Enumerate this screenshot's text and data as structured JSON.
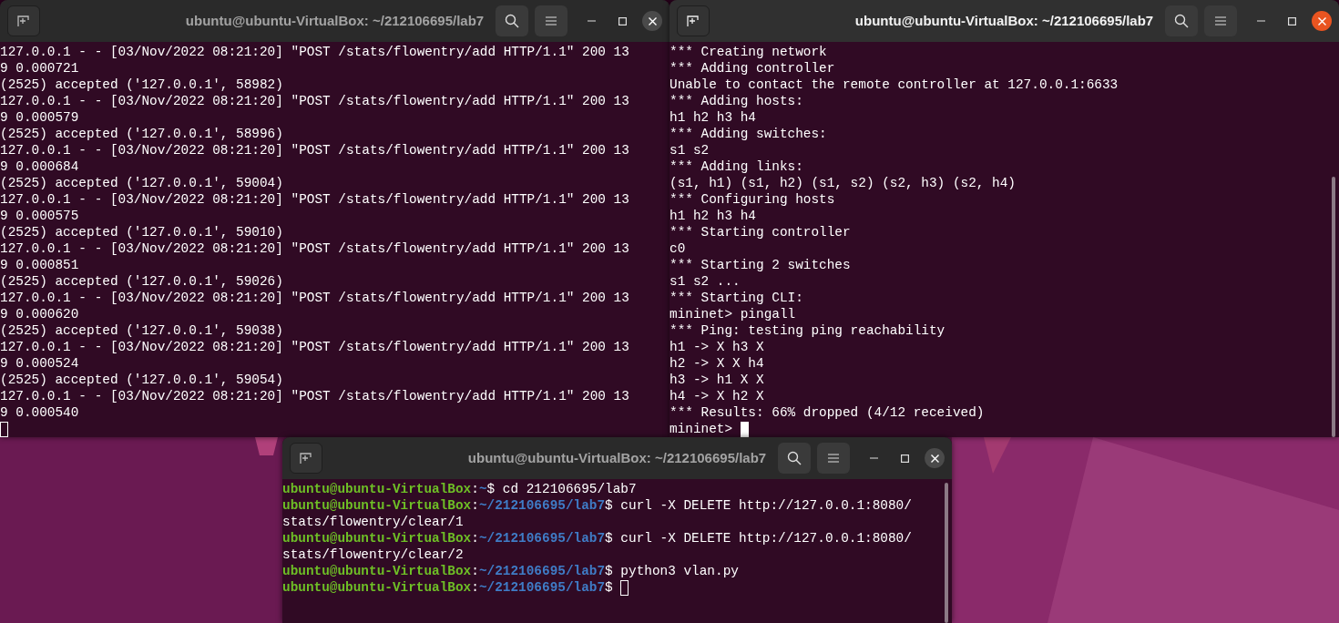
{
  "windows": [
    {
      "title": "ubuntu@ubuntu-VirtualBox: ~/212106695/lab7",
      "focused": false,
      "lines": [
        {
          "kind": "output",
          "text": "127.0.0.1 - - [03/Nov/2022 08:21:20] \"POST /stats/flowentry/add HTTP/1.1\" 200 13"
        },
        {
          "kind": "output",
          "text": "9 0.000721"
        },
        {
          "kind": "output",
          "text": "(2525) accepted ('127.0.0.1', 58982)"
        },
        {
          "kind": "output",
          "text": "127.0.0.1 - - [03/Nov/2022 08:21:20] \"POST /stats/flowentry/add HTTP/1.1\" 200 13"
        },
        {
          "kind": "output",
          "text": "9 0.000579"
        },
        {
          "kind": "output",
          "text": "(2525) accepted ('127.0.0.1', 58996)"
        },
        {
          "kind": "output",
          "text": "127.0.0.1 - - [03/Nov/2022 08:21:20] \"POST /stats/flowentry/add HTTP/1.1\" 200 13"
        },
        {
          "kind": "output",
          "text": "9 0.000684"
        },
        {
          "kind": "output",
          "text": "(2525) accepted ('127.0.0.1', 59004)"
        },
        {
          "kind": "output",
          "text": "127.0.0.1 - - [03/Nov/2022 08:21:20] \"POST /stats/flowentry/add HTTP/1.1\" 200 13"
        },
        {
          "kind": "output",
          "text": "9 0.000575"
        },
        {
          "kind": "output",
          "text": "(2525) accepted ('127.0.0.1', 59010)"
        },
        {
          "kind": "output",
          "text": "127.0.0.1 - - [03/Nov/2022 08:21:20] \"POST /stats/flowentry/add HTTP/1.1\" 200 13"
        },
        {
          "kind": "output",
          "text": "9 0.000851"
        },
        {
          "kind": "output",
          "text": "(2525) accepted ('127.0.0.1', 59026)"
        },
        {
          "kind": "output",
          "text": "127.0.0.1 - - [03/Nov/2022 08:21:20] \"POST /stats/flowentry/add HTTP/1.1\" 200 13"
        },
        {
          "kind": "output",
          "text": "9 0.000620"
        },
        {
          "kind": "output",
          "text": "(2525) accepted ('127.0.0.1', 59038)"
        },
        {
          "kind": "output",
          "text": "127.0.0.1 - - [03/Nov/2022 08:21:20] \"POST /stats/flowentry/add HTTP/1.1\" 200 13"
        },
        {
          "kind": "output",
          "text": "9 0.000524"
        },
        {
          "kind": "output",
          "text": "(2525) accepted ('127.0.0.1', 59054)"
        },
        {
          "kind": "output",
          "text": "127.0.0.1 - - [03/Nov/2022 08:21:20] \"POST /stats/flowentry/add HTTP/1.1\" 200 13"
        },
        {
          "kind": "output",
          "text": "9 0.000540"
        },
        {
          "kind": "output",
          "cursor": true
        }
      ]
    },
    {
      "title": "ubuntu@ubuntu-VirtualBox: ~/212106695/lab7",
      "focused": true,
      "lines": [
        {
          "kind": "output",
          "text": "*** Creating network"
        },
        {
          "kind": "output",
          "text": "*** Adding controller"
        },
        {
          "kind": "output",
          "text": "Unable to contact the remote controller at 127.0.0.1:6633"
        },
        {
          "kind": "output",
          "text": "*** Adding hosts:"
        },
        {
          "kind": "output",
          "text": "h1 h2 h3 h4"
        },
        {
          "kind": "output",
          "text": "*** Adding switches:"
        },
        {
          "kind": "output",
          "text": "s1 s2"
        },
        {
          "kind": "output",
          "text": "*** Adding links:"
        },
        {
          "kind": "output",
          "text": "(s1, h1) (s1, h2) (s1, s2) (s2, h3) (s2, h4)"
        },
        {
          "kind": "output",
          "text": "*** Configuring hosts"
        },
        {
          "kind": "output",
          "text": "h1 h2 h3 h4"
        },
        {
          "kind": "output",
          "text": "*** Starting controller"
        },
        {
          "kind": "output",
          "text": "c0"
        },
        {
          "kind": "output",
          "text": "*** Starting 2 switches"
        },
        {
          "kind": "output",
          "text": "s1 s2 ..."
        },
        {
          "kind": "output",
          "text": "*** Starting CLI:"
        },
        {
          "kind": "output",
          "text": "mininet> pingall"
        },
        {
          "kind": "output",
          "text": "*** Ping: testing ping reachability"
        },
        {
          "kind": "output",
          "text": "h1 -> X h3 X"
        },
        {
          "kind": "output",
          "text": "h2 -> X X h4"
        },
        {
          "kind": "output",
          "text": "h3 -> h1 X X"
        },
        {
          "kind": "output",
          "text": "h4 -> X h2 X"
        },
        {
          "kind": "output",
          "text": "*** Results: 66% dropped (4/12 received)"
        },
        {
          "kind": "output",
          "text": "mininet> ",
          "cursor": true
        }
      ]
    },
    {
      "title": "ubuntu@ubuntu-VirtualBox: ~/212106695/lab7",
      "focused": false,
      "lines": [
        {
          "kind": "prompt",
          "user": "ubuntu@ubuntu-VirtualBox",
          "separator": ":",
          "path": "~",
          "rest": "$ cd 212106695/lab7"
        },
        {
          "kind": "prompt",
          "user": "ubuntu@ubuntu-VirtualBox",
          "separator": ":",
          "path": "~/212106695/lab7",
          "rest": "$ curl -X DELETE http://127.0.0.1:8080/"
        },
        {
          "kind": "output",
          "text": "stats/flowentry/clear/1"
        },
        {
          "kind": "prompt",
          "user": "ubuntu@ubuntu-VirtualBox",
          "separator": ":",
          "path": "~/212106695/lab7",
          "rest": "$ curl -X DELETE http://127.0.0.1:8080/"
        },
        {
          "kind": "output",
          "text": "stats/flowentry/clear/2"
        },
        {
          "kind": "prompt",
          "user": "ubuntu@ubuntu-VirtualBox",
          "separator": ":",
          "path": "~/212106695/lab7",
          "rest": "$ python3 vlan.py"
        },
        {
          "kind": "prompt",
          "user": "ubuntu@ubuntu-VirtualBox",
          "separator": ":",
          "path": "~/212106695/lab7",
          "rest": "$ ",
          "cursor": true
        }
      ]
    }
  ]
}
